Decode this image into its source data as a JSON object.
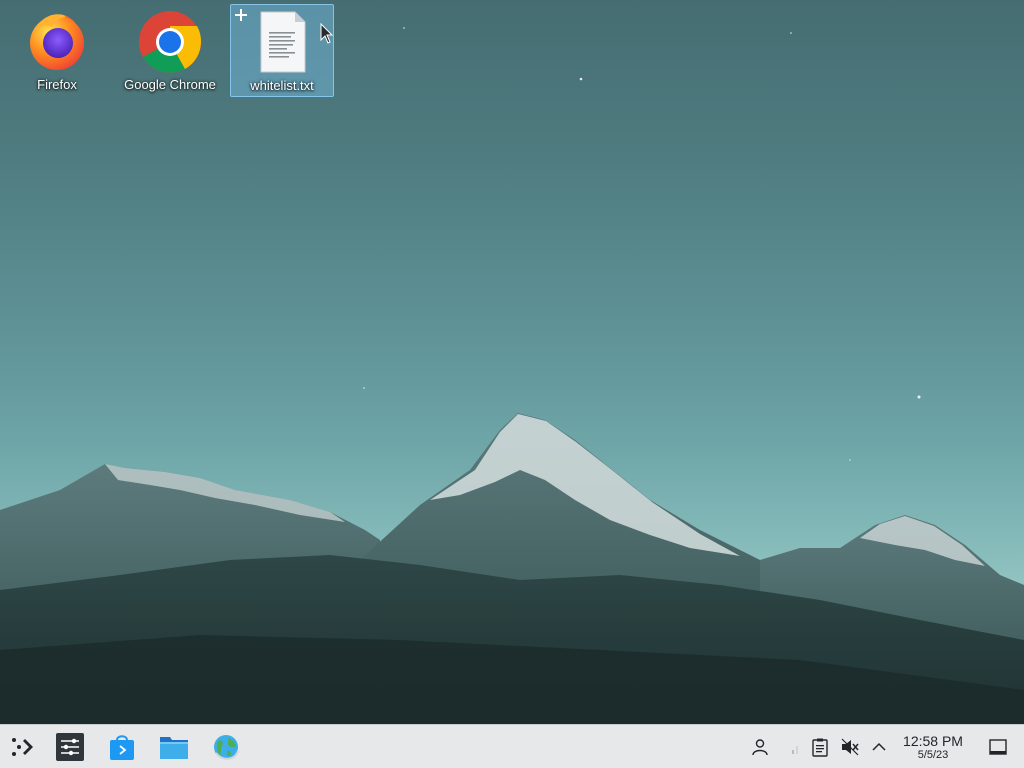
{
  "desktop": {
    "icons": [
      {
        "label": "Firefox",
        "icon": "firefox-icon",
        "selected": false
      },
      {
        "label": "Google Chrome",
        "icon": "chrome-icon",
        "selected": false
      },
      {
        "label": "whitelist.txt",
        "icon": "text-file-icon",
        "selected": true
      }
    ]
  },
  "taskbar": {
    "launcher_icon": "app-launcher-icon",
    "pinned": [
      {
        "name": "System Settings",
        "icon": "settings-icon"
      },
      {
        "name": "Discover",
        "icon": "store-bag-icon"
      },
      {
        "name": "Dolphin",
        "icon": "folder-icon"
      },
      {
        "name": "Web Browser",
        "icon": "globe-icon"
      }
    ],
    "tray": [
      "user-icon",
      "network-icon",
      "clipboard-icon",
      "volume-muted-icon",
      "chevron-up-icon"
    ],
    "clock": {
      "time": "12:58 PM",
      "date": "5/5/23"
    },
    "show_desktop_icon": "show-desktop-icon"
  },
  "colors": {
    "taskbar_bg": "#e7e8ea",
    "selection_bg": "#78bee6",
    "label_text": "#ffffff"
  }
}
